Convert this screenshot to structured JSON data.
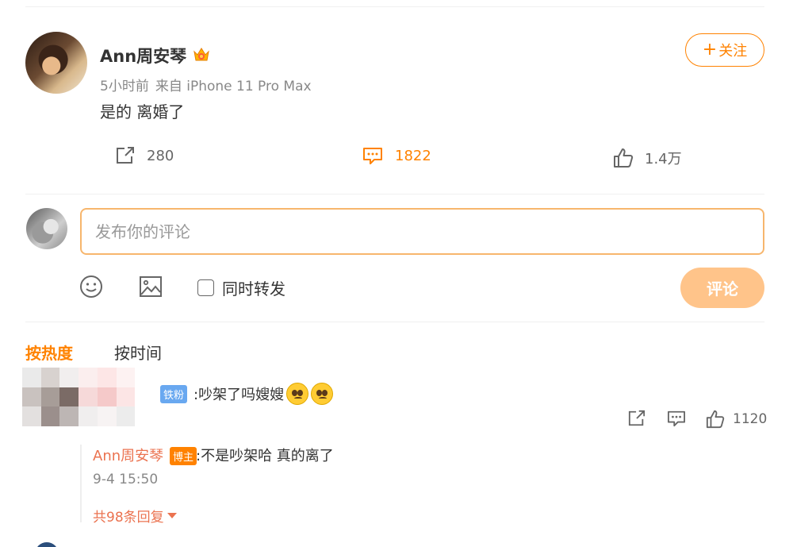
{
  "post": {
    "author": "Ann周安琴",
    "time": "5小时前",
    "source": "来自 iPhone 11 Pro Max",
    "text": "是的 离婚了",
    "follow_label": "关注",
    "reposts": "280",
    "comments": "1822",
    "likes": "1.4万"
  },
  "compose": {
    "placeholder": "发布你的评论",
    "repost_label": "同时转发",
    "submit_label": "评论"
  },
  "sort": {
    "hot": "按热度",
    "time": "按时间"
  },
  "comment": {
    "badge": "铁粉",
    "text": ":吵架了吗嫂嫂",
    "likes": "1120"
  },
  "reply": {
    "author": "Ann周安琴",
    "badge": "博主",
    "text": ":不是吵架哈 真的离了",
    "time": "9-4 15:50",
    "more": "共98条回复"
  },
  "colors": {
    "accent": "#ff8200",
    "link": "#eb7350",
    "fan_badge": "#69a8f0"
  }
}
